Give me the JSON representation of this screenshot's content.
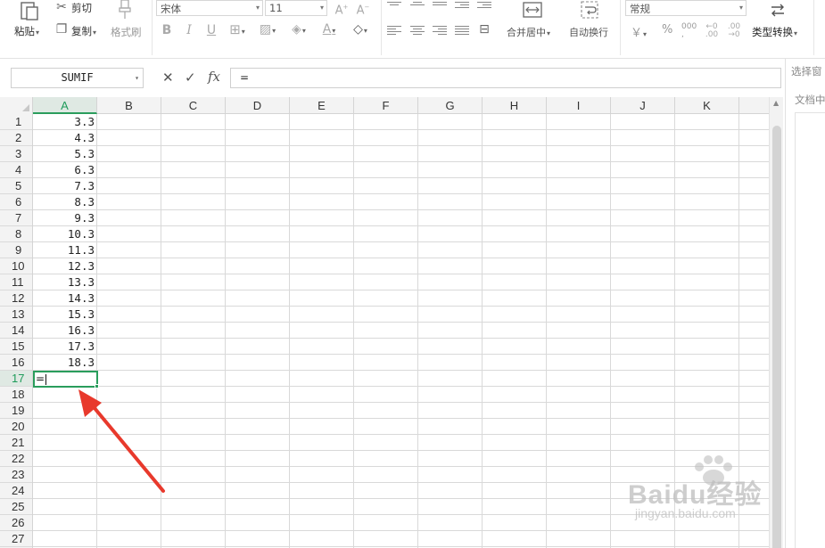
{
  "ribbon": {
    "paste_label": "粘贴",
    "cut_label": "剪切",
    "copy_label": "复制",
    "format_painter_label": "格式刷",
    "font_name": "宋体",
    "font_size": "11",
    "merge_center_label": "合并居中",
    "wrap_text_label": "自动换行",
    "number_format": "常规",
    "convert_type_label": "类型转换",
    "currency_symbol": "￥",
    "percent_symbol": "%",
    "thousands_symbol": "000"
  },
  "formula_bar": {
    "name_box": "SUMIF",
    "cancel_symbol": "✕",
    "confirm_symbol": "✓",
    "fx_label": "fx",
    "formula": "="
  },
  "side_pane": {
    "title": "选择窗",
    "doc_label": "文档中"
  },
  "sheet": {
    "columns": [
      "A",
      "B",
      "C",
      "D",
      "E",
      "F",
      "G",
      "H",
      "I",
      "J",
      "K"
    ],
    "active_column": "A",
    "rows": [
      "1",
      "2",
      "3",
      "4",
      "5",
      "6",
      "7",
      "8",
      "9",
      "10",
      "11",
      "12",
      "13",
      "14",
      "15",
      "16",
      "17",
      "18",
      "19",
      "20",
      "21",
      "22",
      "23",
      "24",
      "25",
      "26",
      "27"
    ],
    "active_row": "17",
    "column_a_values": [
      "3.3",
      "4.3",
      "5.3",
      "6.3",
      "7.3",
      "8.3",
      "9.3",
      "10.3",
      "11.3",
      "12.3",
      "13.3",
      "14.3",
      "15.3",
      "16.3",
      "17.3",
      "18.3"
    ],
    "active_cell_input": "="
  },
  "annotation": {
    "arrow_color": "#e8392c"
  },
  "watermark": {
    "brand": "Baidu经验",
    "url": "jingyan.baidu.com"
  },
  "colors": {
    "accent_green": "#2a9d5c",
    "header_bg": "#f3f3f3",
    "grid_line": "#d9d9d9"
  }
}
